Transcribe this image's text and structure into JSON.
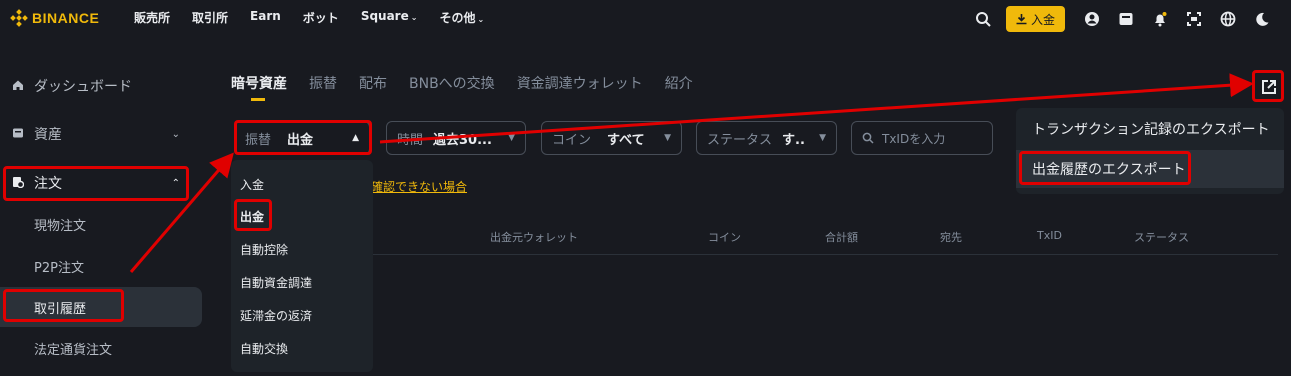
{
  "header": {
    "logo": "BINANCE",
    "nav": [
      "販売所",
      "取引所",
      "Earn",
      "ボット",
      "Square",
      "その他"
    ],
    "deposit_label": "入金",
    "icons": [
      "search-icon",
      "download-icon",
      "user-icon",
      "wallet-icon",
      "bell-icon",
      "scan-icon",
      "globe-icon",
      "moon-icon"
    ]
  },
  "sidebar": {
    "dashboard": "ダッシュボード",
    "assets": "資産",
    "orders": "注文",
    "sub": [
      "現物注文",
      "P2P注文",
      "取引履歴",
      "法定通貨注文"
    ]
  },
  "tabs": [
    "暗号資産",
    "振替",
    "配布",
    "BNBへの交換",
    "資金調達ウォレット",
    "紹介"
  ],
  "filters": {
    "type_label": "振替",
    "type_value": "出金",
    "time_label": "時間",
    "time_value": "過去30...",
    "coin_label": "コイン",
    "coin_value": "すべて",
    "status_label": "ステータス",
    "status_value": "す..",
    "txid_placeholder": "TxIDを入力"
  },
  "type_dropdown": [
    "入金",
    "出金",
    "自動控除",
    "自動資金調達",
    "延滞金の返済",
    "自動交換"
  ],
  "help_link": "確認できない場合",
  "table_headers": [
    "出金元ウォレット",
    "コイン",
    "合計額",
    "宛先",
    "TxID",
    "ステータス"
  ],
  "export_menu": {
    "items": [
      "トランザクション記録のエクスポート",
      "出金履歴のエクスポート"
    ]
  },
  "colors": {
    "accent": "#f0b90b",
    "annotation": "#e00000",
    "background": "#181a20"
  }
}
